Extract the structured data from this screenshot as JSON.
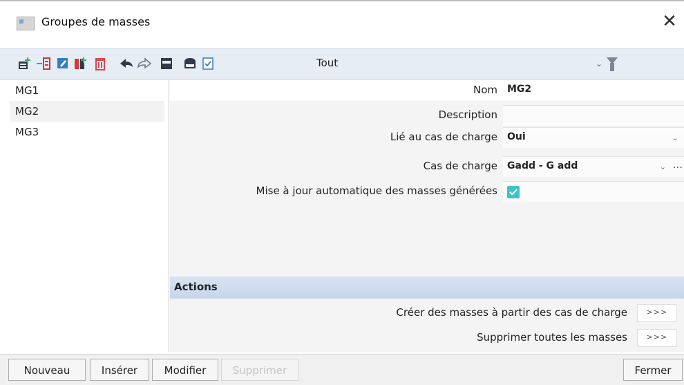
{
  "window": {
    "title": "Groupes de masses",
    "close_glyph": "✕"
  },
  "toolbar": {
    "icons": [
      "new-icon",
      "insert-icon",
      "edit-icon",
      "copy-icon",
      "delete-icon",
      "undo-icon",
      "redo-icon",
      "table-icon",
      "save-icon",
      "checklist-icon"
    ],
    "filter_label": "Tout",
    "filter_chevron": "⌄"
  },
  "groups": [
    {
      "label": "MG1"
    },
    {
      "label": "MG2"
    },
    {
      "label": "MG3"
    }
  ],
  "selected_group": "MG2",
  "properties": {
    "nom_label": "Nom",
    "nom_value": "MG2",
    "description_label": "Description",
    "description_value": "",
    "lie_label": "Lié au cas de charge",
    "lie_value": "Oui",
    "cas_label": "Cas de charge",
    "cas_value": "Gadd - G add",
    "maj_label": "Mise à jour automatique des masses générées",
    "maj_checked": true,
    "dropdown_glyph": "⌄",
    "more_glyph": "..."
  },
  "actions": {
    "header": "Actions",
    "items": [
      {
        "label": "Créer des masses à partir des cas de charge",
        "button": ">>>"
      },
      {
        "label": "Supprimer toutes les masses",
        "button": ">>>"
      }
    ]
  },
  "buttons": {
    "nouveau": "Nouveau",
    "inserer": "Insérer",
    "modifier": "Modifier",
    "supprimer": "Supprimer",
    "fermer": "Fermer"
  },
  "colors": {
    "accent_check": "#3fc2c9",
    "toolbar_bg": "#e6edf5",
    "actions_header": "#d0deef"
  }
}
